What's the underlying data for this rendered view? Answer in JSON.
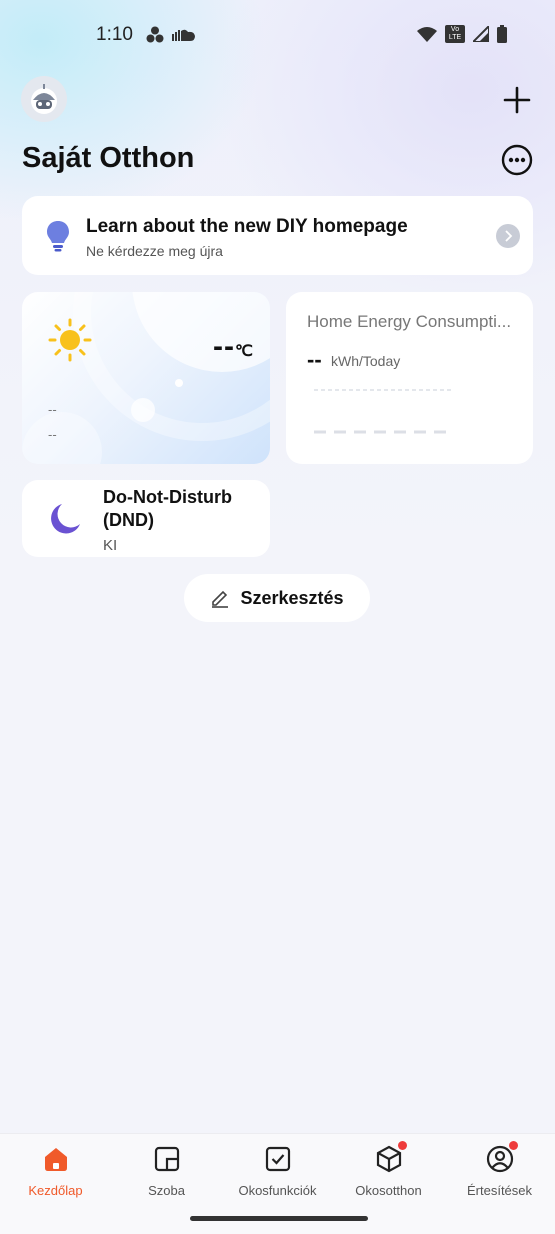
{
  "status_bar": {
    "time": "1:10",
    "lte_badge": "Vo LTE"
  },
  "header": {
    "title": "Saját Otthon"
  },
  "banner": {
    "title": "Learn about the new DIY homepage",
    "subtitle": "Ne kérdezze meg újra"
  },
  "weather": {
    "temperature": "--",
    "unit": "℃",
    "line1": "--",
    "line2": "--"
  },
  "energy": {
    "title": "Home Energy Consumpti...",
    "value": "--",
    "unit": "kWh/Today"
  },
  "dnd": {
    "title": "Do-Not-Disturb (DND)",
    "status": "KI"
  },
  "edit_button": {
    "label": "Szerkesztés"
  },
  "bottom_nav": {
    "active_color": "#f05a2a",
    "items": [
      {
        "label": "Kezdőlap",
        "icon": "home-icon",
        "active": true
      },
      {
        "label": "Szoba",
        "icon": "room-icon",
        "active": false
      },
      {
        "label": "Okosfunkciók",
        "icon": "checkbox-icon",
        "active": false
      },
      {
        "label": "Okosotthon",
        "icon": "cube-icon",
        "active": false,
        "badge": true
      },
      {
        "label": "Értesítések",
        "icon": "profile-icon",
        "active": false,
        "badge": true
      }
    ]
  }
}
